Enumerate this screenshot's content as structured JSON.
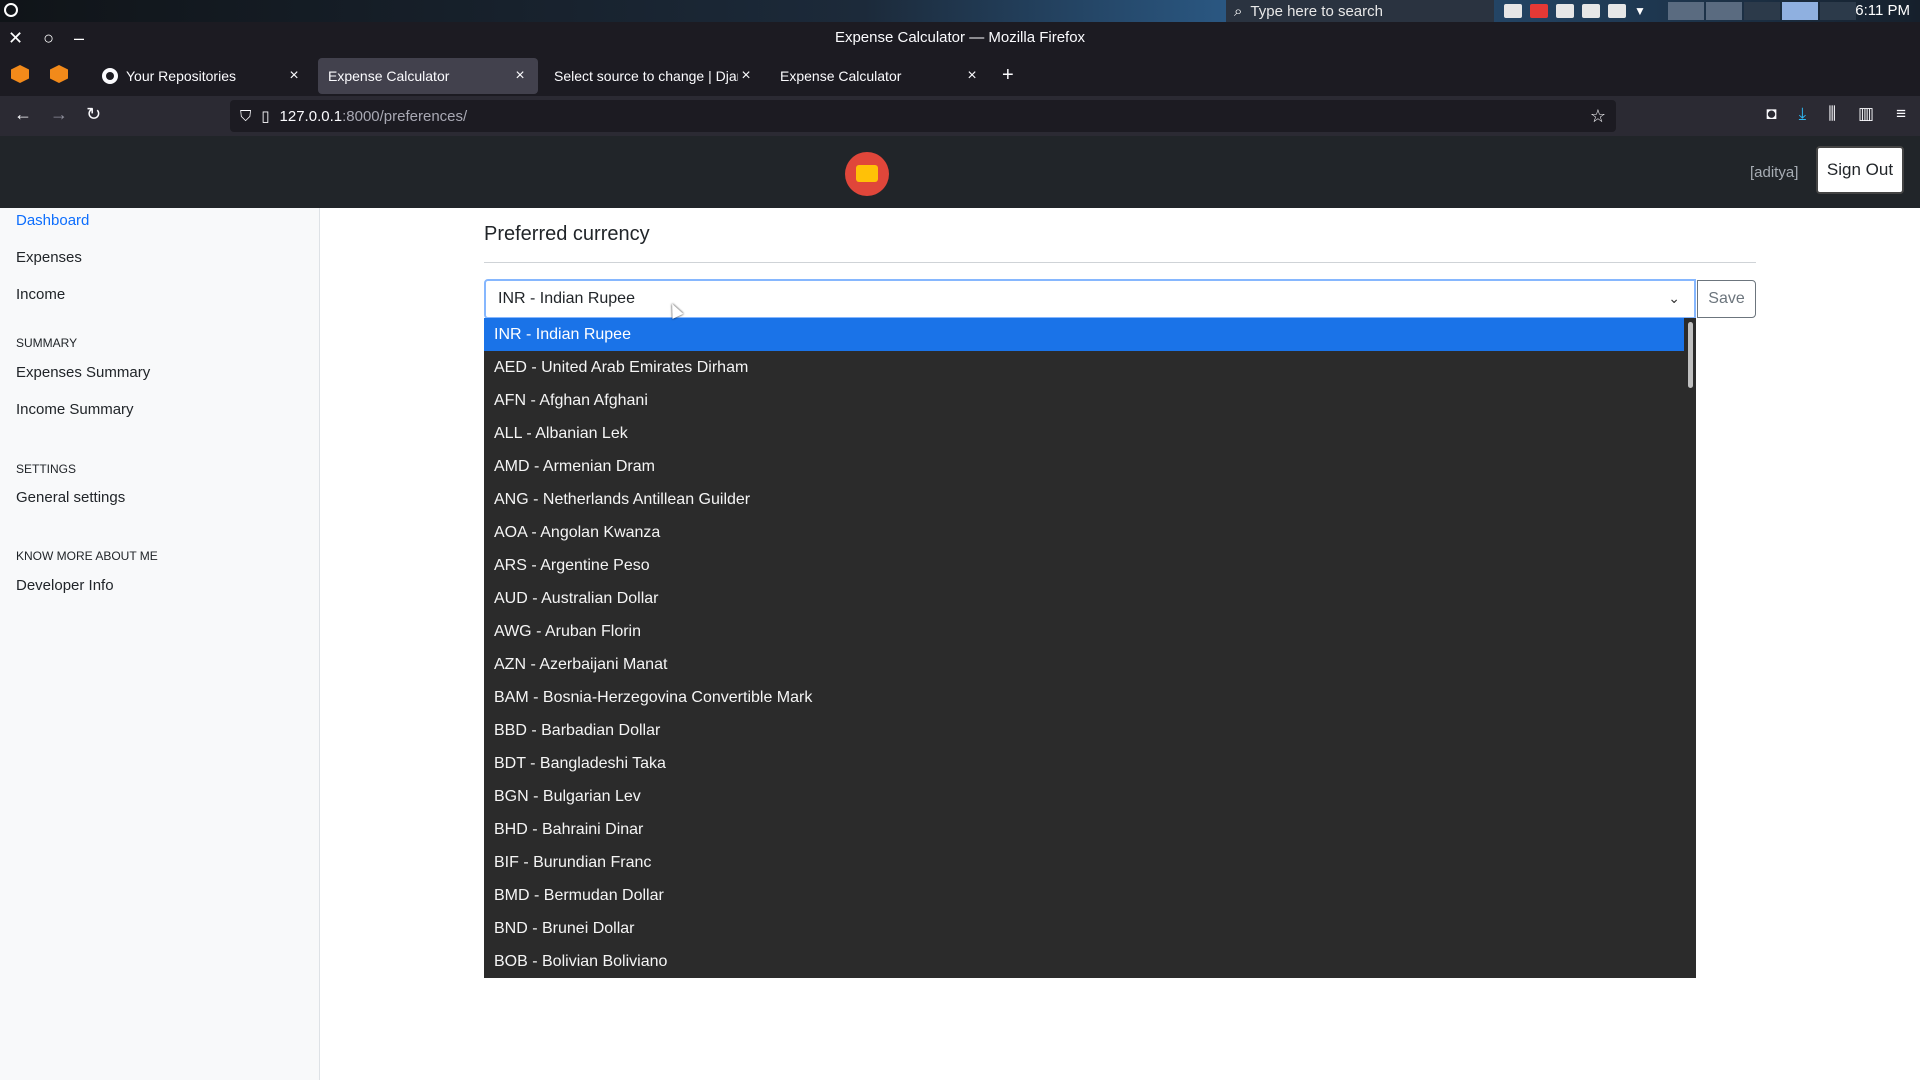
{
  "os": {
    "search_placeholder": "Type here to search",
    "clock": "6:11 PM"
  },
  "window": {
    "title": "Expense Calculator — Mozilla Firefox"
  },
  "tabs": [
    {
      "label": "Your Repositories"
    },
    {
      "label": "Expense Calculator"
    },
    {
      "label": "Select source to change | Django"
    },
    {
      "label": "Expense Calculator"
    }
  ],
  "url": {
    "host": "127.0.0.1",
    "path": ":8000/preferences/"
  },
  "header": {
    "username": "[aditya]",
    "signout_label": "Sign Out"
  },
  "sidebar": {
    "dashboard": "Dashboard",
    "expenses": "Expenses",
    "income": "Income",
    "summary_heading": "SUMMARY",
    "expenses_summary": "Expenses Summary",
    "income_summary": "Income Summary",
    "settings_heading": "SETTINGS",
    "general_settings": "General settings",
    "know_more_heading": "KNOW MORE ABOUT ME",
    "developer_info": "Developer Info"
  },
  "main": {
    "title": "Preferred currency",
    "selected_currency": "INR - Indian Rupee",
    "save_label": "Save"
  },
  "currency_options": [
    "INR - Indian Rupee",
    "AED - United Arab Emirates Dirham",
    "AFN - Afghan Afghani",
    "ALL - Albanian Lek",
    "AMD - Armenian Dram",
    "ANG - Netherlands Antillean Guilder",
    "AOA - Angolan Kwanza",
    "ARS - Argentine Peso",
    "AUD - Australian Dollar",
    "AWG - Aruban Florin",
    "AZN - Azerbaijani Manat",
    "BAM - Bosnia-Herzegovina Convertible Mark",
    "BBD - Barbadian Dollar",
    "BDT - Bangladeshi Taka",
    "BGN - Bulgarian Lev",
    "BHD - Bahraini Dinar",
    "BIF - Burundian Franc",
    "BMD - Bermudan Dollar",
    "BND - Brunei Dollar",
    "BOB - Bolivian Boliviano"
  ],
  "colors": {
    "header_bg": "#212529",
    "accent": "#0d6efd",
    "dropdown_selected": "#1a73e8"
  }
}
